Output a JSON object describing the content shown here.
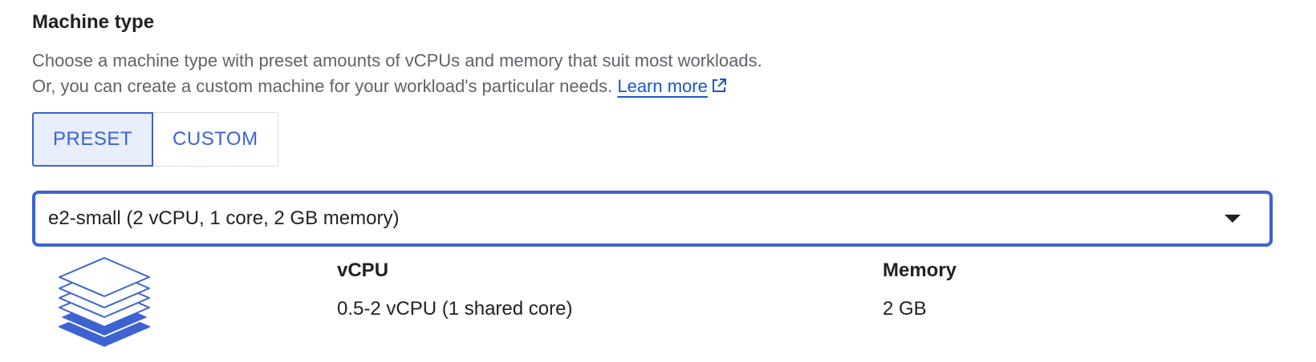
{
  "section": {
    "title": "Machine type",
    "description_line1": "Choose a machine type with preset amounts of vCPUs and memory that suit most workloads.",
    "description_line2": "Or, you can create a custom machine for your workload's particular needs.",
    "learn_more": "Learn more"
  },
  "toggle": {
    "preset_label": "PRESET",
    "custom_label": "CUSTOM",
    "selected": "PRESET"
  },
  "select": {
    "value": "e2-small (2 vCPU, 1 core, 2 GB memory)"
  },
  "specs": {
    "vcpu_label": "vCPU",
    "vcpu_value": "0.5-2 vCPU (1 shared core)",
    "memory_label": "Memory",
    "memory_value": "2 GB"
  },
  "icons": {
    "external_link": "external-link-icon",
    "machine": "stacked-layers-icon",
    "dropdown": "caret-down-icon"
  },
  "colors": {
    "accent": "#3d63d0",
    "link": "#1a56c4",
    "selected_bg": "#e8eefb",
    "muted_text": "#5f6368"
  }
}
